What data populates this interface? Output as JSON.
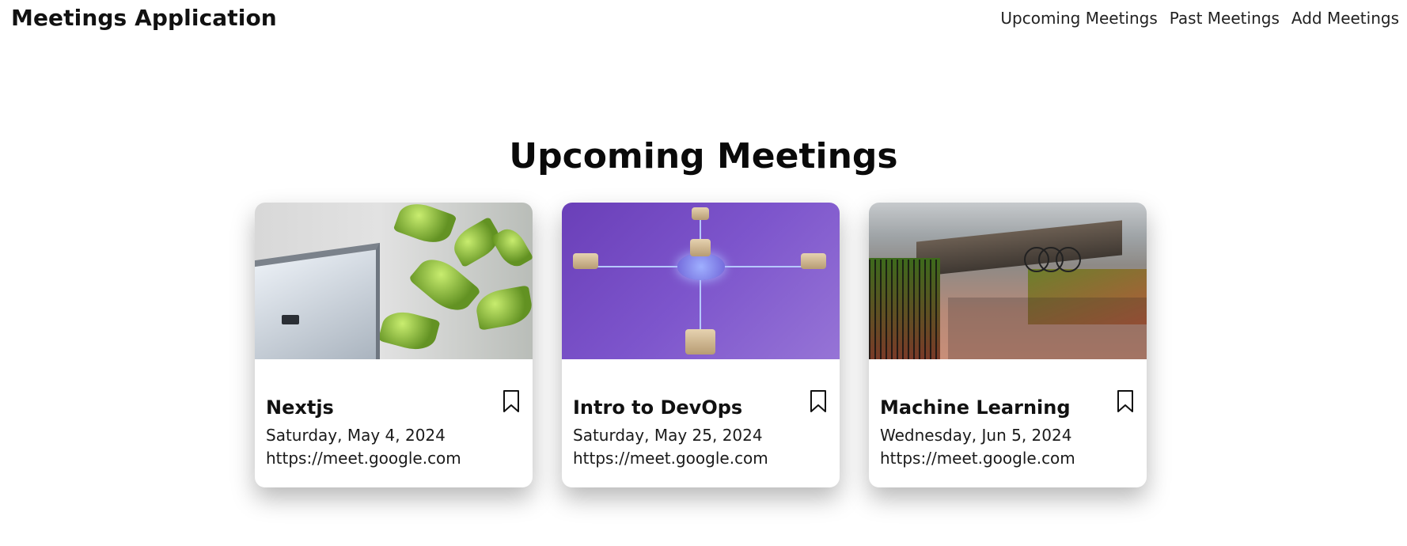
{
  "app": {
    "title": "Meetings Application"
  },
  "nav": {
    "items": [
      "Upcoming Meetings",
      "Past Meetings",
      "Add Meetings"
    ]
  },
  "page": {
    "title": "Upcoming Meetings"
  },
  "meetings": [
    {
      "title": "Nextjs",
      "date": "Saturday, May 4, 2024",
      "link": "https://meet.google.com",
      "image": "laptop-with-plant"
    },
    {
      "title": "Intro to DevOps",
      "date": "Saturday, May 25, 2024",
      "link": "https://meet.google.com",
      "image": "purple-network-hub"
    },
    {
      "title": "Machine Learning",
      "date": "Wednesday, Jun 5, 2024",
      "link": "https://meet.google.com",
      "image": "park-with-bicycles"
    }
  ],
  "icons": {
    "bookmark": "bookmark-icon"
  },
  "colors": {
    "text": "#111111",
    "background": "#ffffff",
    "accent_purple": "#7d55cc"
  }
}
